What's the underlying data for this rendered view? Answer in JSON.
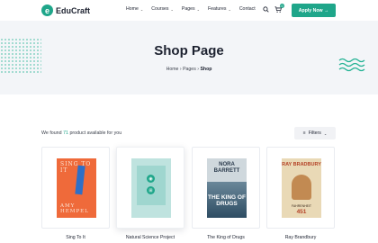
{
  "brand": {
    "logo_letter": "e",
    "name": "EduCraft"
  },
  "nav": {
    "items": [
      {
        "label": "Home",
        "caret": "⌄"
      },
      {
        "label": "Courses",
        "caret": "⌄"
      },
      {
        "label": "Pages",
        "caret": "⌄"
      },
      {
        "label": "Features",
        "caret": "⌄"
      },
      {
        "label": "Contact",
        "caret": ""
      }
    ],
    "cart_count": "0",
    "apply_label": "Apply Now →"
  },
  "hero": {
    "title": "Shop Page",
    "breadcrumb": [
      "Home",
      "Pages",
      "Shop"
    ],
    "separator": "›"
  },
  "toolbar": {
    "result_prefix": "We found ",
    "result_count": "71",
    "result_suffix": " product available for you",
    "filters_label": "Filters"
  },
  "products": [
    {
      "name": "Sing To It",
      "cover_lines": [
        "SING TO IT",
        "AMY HEMPEL"
      ]
    },
    {
      "name": "Natural Science Project",
      "cover_lines": []
    },
    {
      "name": "The King of Drugs",
      "cover_lines": [
        "NORA BARRETT",
        "THE KING OF DRUGS"
      ]
    },
    {
      "name": "Ray Brandbury",
      "cover_lines": [
        "RAY BRADBURY",
        "FAHRENHEIT",
        "451"
      ]
    }
  ],
  "colors": {
    "accent": "#1fa68a",
    "hero_bg": "#f3f5f8",
    "text": "#1d2230"
  },
  "icons": {
    "search": "search-icon",
    "cart": "cart-icon",
    "filter": "filter-icon",
    "quick_view": "eye-icon",
    "add_cart": "cart-icon"
  }
}
